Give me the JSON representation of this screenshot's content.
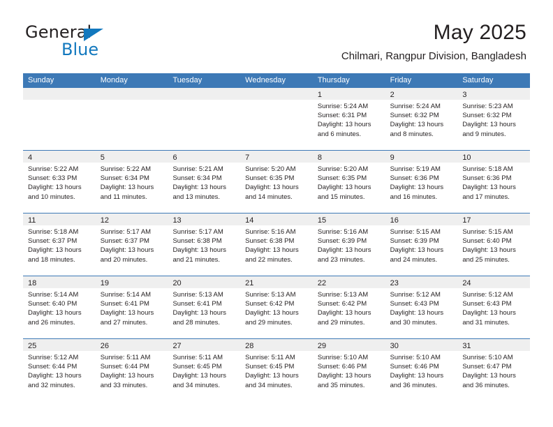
{
  "brand": {
    "name_part1": "General",
    "name_part2": "Blue",
    "flag_icon": "triangle-flag-icon"
  },
  "header": {
    "title": "May 2025",
    "subtitle": "Chilmari, Rangpur Division, Bangladesh"
  },
  "colors": {
    "header_blue": "#3d79b6",
    "brand_blue": "#1278be",
    "day_band_gray": "#efefef",
    "text": "#231f20"
  },
  "weekdays": [
    "Sunday",
    "Monday",
    "Tuesday",
    "Wednesday",
    "Thursday",
    "Friday",
    "Saturday"
  ],
  "weeks": [
    [
      {
        "day": "",
        "empty": true,
        "sunrise": "",
        "sunset": "",
        "daylight1": "",
        "daylight2": ""
      },
      {
        "day": "",
        "empty": true,
        "sunrise": "",
        "sunset": "",
        "daylight1": "",
        "daylight2": ""
      },
      {
        "day": "",
        "empty": true,
        "sunrise": "",
        "sunset": "",
        "daylight1": "",
        "daylight2": ""
      },
      {
        "day": "",
        "empty": true,
        "sunrise": "",
        "sunset": "",
        "daylight1": "",
        "daylight2": ""
      },
      {
        "day": "1",
        "empty": false,
        "sunrise": "Sunrise: 5:24 AM",
        "sunset": "Sunset: 6:31 PM",
        "daylight1": "Daylight: 13 hours",
        "daylight2": "and 6 minutes."
      },
      {
        "day": "2",
        "empty": false,
        "sunrise": "Sunrise: 5:24 AM",
        "sunset": "Sunset: 6:32 PM",
        "daylight1": "Daylight: 13 hours",
        "daylight2": "and 8 minutes."
      },
      {
        "day": "3",
        "empty": false,
        "sunrise": "Sunrise: 5:23 AM",
        "sunset": "Sunset: 6:32 PM",
        "daylight1": "Daylight: 13 hours",
        "daylight2": "and 9 minutes."
      }
    ],
    [
      {
        "day": "4",
        "empty": false,
        "sunrise": "Sunrise: 5:22 AM",
        "sunset": "Sunset: 6:33 PM",
        "daylight1": "Daylight: 13 hours",
        "daylight2": "and 10 minutes."
      },
      {
        "day": "5",
        "empty": false,
        "sunrise": "Sunrise: 5:22 AM",
        "sunset": "Sunset: 6:34 PM",
        "daylight1": "Daylight: 13 hours",
        "daylight2": "and 11 minutes."
      },
      {
        "day": "6",
        "empty": false,
        "sunrise": "Sunrise: 5:21 AM",
        "sunset": "Sunset: 6:34 PM",
        "daylight1": "Daylight: 13 hours",
        "daylight2": "and 13 minutes."
      },
      {
        "day": "7",
        "empty": false,
        "sunrise": "Sunrise: 5:20 AM",
        "sunset": "Sunset: 6:35 PM",
        "daylight1": "Daylight: 13 hours",
        "daylight2": "and 14 minutes."
      },
      {
        "day": "8",
        "empty": false,
        "sunrise": "Sunrise: 5:20 AM",
        "sunset": "Sunset: 6:35 PM",
        "daylight1": "Daylight: 13 hours",
        "daylight2": "and 15 minutes."
      },
      {
        "day": "9",
        "empty": false,
        "sunrise": "Sunrise: 5:19 AM",
        "sunset": "Sunset: 6:36 PM",
        "daylight1": "Daylight: 13 hours",
        "daylight2": "and 16 minutes."
      },
      {
        "day": "10",
        "empty": false,
        "sunrise": "Sunrise: 5:18 AM",
        "sunset": "Sunset: 6:36 PM",
        "daylight1": "Daylight: 13 hours",
        "daylight2": "and 17 minutes."
      }
    ],
    [
      {
        "day": "11",
        "empty": false,
        "sunrise": "Sunrise: 5:18 AM",
        "sunset": "Sunset: 6:37 PM",
        "daylight1": "Daylight: 13 hours",
        "daylight2": "and 18 minutes."
      },
      {
        "day": "12",
        "empty": false,
        "sunrise": "Sunrise: 5:17 AM",
        "sunset": "Sunset: 6:37 PM",
        "daylight1": "Daylight: 13 hours",
        "daylight2": "and 20 minutes."
      },
      {
        "day": "13",
        "empty": false,
        "sunrise": "Sunrise: 5:17 AM",
        "sunset": "Sunset: 6:38 PM",
        "daylight1": "Daylight: 13 hours",
        "daylight2": "and 21 minutes."
      },
      {
        "day": "14",
        "empty": false,
        "sunrise": "Sunrise: 5:16 AM",
        "sunset": "Sunset: 6:38 PM",
        "daylight1": "Daylight: 13 hours",
        "daylight2": "and 22 minutes."
      },
      {
        "day": "15",
        "empty": false,
        "sunrise": "Sunrise: 5:16 AM",
        "sunset": "Sunset: 6:39 PM",
        "daylight1": "Daylight: 13 hours",
        "daylight2": "and 23 minutes."
      },
      {
        "day": "16",
        "empty": false,
        "sunrise": "Sunrise: 5:15 AM",
        "sunset": "Sunset: 6:39 PM",
        "daylight1": "Daylight: 13 hours",
        "daylight2": "and 24 minutes."
      },
      {
        "day": "17",
        "empty": false,
        "sunrise": "Sunrise: 5:15 AM",
        "sunset": "Sunset: 6:40 PM",
        "daylight1": "Daylight: 13 hours",
        "daylight2": "and 25 minutes."
      }
    ],
    [
      {
        "day": "18",
        "empty": false,
        "sunrise": "Sunrise: 5:14 AM",
        "sunset": "Sunset: 6:40 PM",
        "daylight1": "Daylight: 13 hours",
        "daylight2": "and 26 minutes."
      },
      {
        "day": "19",
        "empty": false,
        "sunrise": "Sunrise: 5:14 AM",
        "sunset": "Sunset: 6:41 PM",
        "daylight1": "Daylight: 13 hours",
        "daylight2": "and 27 minutes."
      },
      {
        "day": "20",
        "empty": false,
        "sunrise": "Sunrise: 5:13 AM",
        "sunset": "Sunset: 6:41 PM",
        "daylight1": "Daylight: 13 hours",
        "daylight2": "and 28 minutes."
      },
      {
        "day": "21",
        "empty": false,
        "sunrise": "Sunrise: 5:13 AM",
        "sunset": "Sunset: 6:42 PM",
        "daylight1": "Daylight: 13 hours",
        "daylight2": "and 29 minutes."
      },
      {
        "day": "22",
        "empty": false,
        "sunrise": "Sunrise: 5:13 AM",
        "sunset": "Sunset: 6:42 PM",
        "daylight1": "Daylight: 13 hours",
        "daylight2": "and 29 minutes."
      },
      {
        "day": "23",
        "empty": false,
        "sunrise": "Sunrise: 5:12 AM",
        "sunset": "Sunset: 6:43 PM",
        "daylight1": "Daylight: 13 hours",
        "daylight2": "and 30 minutes."
      },
      {
        "day": "24",
        "empty": false,
        "sunrise": "Sunrise: 5:12 AM",
        "sunset": "Sunset: 6:43 PM",
        "daylight1": "Daylight: 13 hours",
        "daylight2": "and 31 minutes."
      }
    ],
    [
      {
        "day": "25",
        "empty": false,
        "sunrise": "Sunrise: 5:12 AM",
        "sunset": "Sunset: 6:44 PM",
        "daylight1": "Daylight: 13 hours",
        "daylight2": "and 32 minutes."
      },
      {
        "day": "26",
        "empty": false,
        "sunrise": "Sunrise: 5:11 AM",
        "sunset": "Sunset: 6:44 PM",
        "daylight1": "Daylight: 13 hours",
        "daylight2": "and 33 minutes."
      },
      {
        "day": "27",
        "empty": false,
        "sunrise": "Sunrise: 5:11 AM",
        "sunset": "Sunset: 6:45 PM",
        "daylight1": "Daylight: 13 hours",
        "daylight2": "and 34 minutes."
      },
      {
        "day": "28",
        "empty": false,
        "sunrise": "Sunrise: 5:11 AM",
        "sunset": "Sunset: 6:45 PM",
        "daylight1": "Daylight: 13 hours",
        "daylight2": "and 34 minutes."
      },
      {
        "day": "29",
        "empty": false,
        "sunrise": "Sunrise: 5:10 AM",
        "sunset": "Sunset: 6:46 PM",
        "daylight1": "Daylight: 13 hours",
        "daylight2": "and 35 minutes."
      },
      {
        "day": "30",
        "empty": false,
        "sunrise": "Sunrise: 5:10 AM",
        "sunset": "Sunset: 6:46 PM",
        "daylight1": "Daylight: 13 hours",
        "daylight2": "and 36 minutes."
      },
      {
        "day": "31",
        "empty": false,
        "sunrise": "Sunrise: 5:10 AM",
        "sunset": "Sunset: 6:47 PM",
        "daylight1": "Daylight: 13 hours",
        "daylight2": "and 36 minutes."
      }
    ]
  ]
}
